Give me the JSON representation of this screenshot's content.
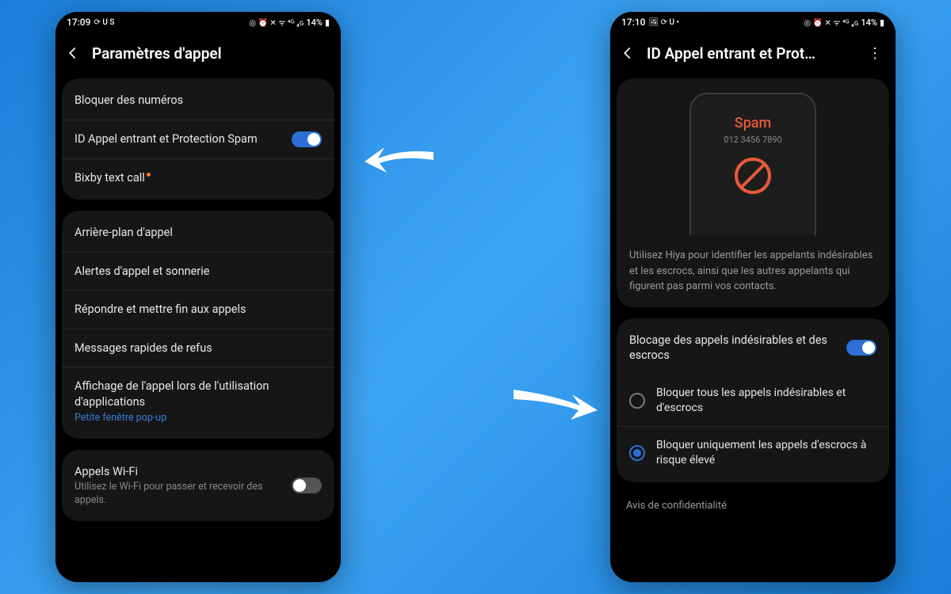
{
  "phone1": {
    "status": {
      "time": "17:09",
      "left_icons": "⟳ U S",
      "right_icons": "◎ ⏰ ✕ ᯤ ⁴ᴳ ₄ɢ",
      "battery": "14%"
    },
    "header": {
      "title": "Paramètres d'appel"
    },
    "section1": {
      "block_numbers": "Bloquer des numéros",
      "caller_id": "ID Appel entrant et Protection Spam",
      "bixby": "Bixby text call"
    },
    "section2": {
      "background": "Arrière-plan d'appel",
      "alerts": "Alertes d'appel et sonnerie",
      "answer": "Répondre et mettre fin aux appels",
      "quick_reject": "Messages rapides de refus",
      "display_during_apps": "Affichage de l'appel lors de l'utilisation d'applications",
      "display_sub": "Petite fenêtre pop-up"
    },
    "section3": {
      "wifi_calls": "Appels Wi-Fi",
      "wifi_sub": "Utilisez le Wi-Fi pour passer et recevoir des appels."
    }
  },
  "phone2": {
    "status": {
      "time": "17:10",
      "left_icons": "🖼 ⟳ U •",
      "right_icons": "◎ ⏰ ✕ ᯤ ⁴ᴳ ₄ɢ",
      "battery": "14%"
    },
    "header": {
      "title": "ID Appel entrant et Prot…"
    },
    "spam": {
      "label": "Spam",
      "number": "012 3456 7890",
      "desc": "Utilisez Hiya pour identifier les appelants indésirables et les escrocs, ainsi que les autres appelants qui figurent pas parmi vos contacts."
    },
    "section2": {
      "spam_block": "Blocage des appels indésirables et des escrocs",
      "opt_all": "Bloquer tous les appels indésirables et d'escrocs",
      "opt_high": "Bloquer uniquement les appels d'escrocs à risque élevé"
    },
    "footer": "Avis de confidentialité"
  }
}
